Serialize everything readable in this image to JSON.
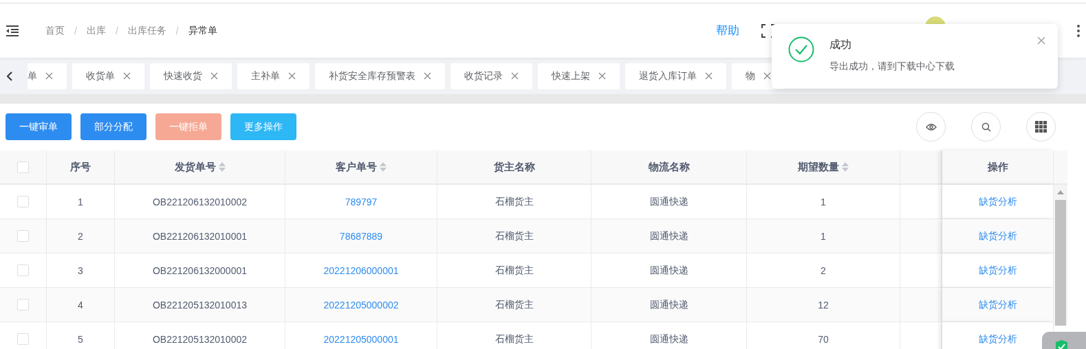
{
  "header": {
    "breadcrumb": [
      "首页",
      "出库",
      "出库任务",
      "异常单"
    ],
    "separators": [
      "/",
      "/",
      "/"
    ],
    "help": "帮助"
  },
  "tabs": [
    {
      "label": "单"
    },
    {
      "label": "收货单"
    },
    {
      "label": "快速收货"
    },
    {
      "label": "主补单"
    },
    {
      "label": "补货安全库存预警表"
    },
    {
      "label": "收货记录"
    },
    {
      "label": "快速上架"
    },
    {
      "label": "退货入库订单"
    },
    {
      "label": "物"
    }
  ],
  "toast": {
    "title": "成功",
    "message": "导出成功，请到下载中心下载"
  },
  "actions": [
    {
      "label": "一键审单",
      "kind": "primary",
      "disabled": false
    },
    {
      "label": "部分分配",
      "kind": "primary",
      "disabled": false
    },
    {
      "label": "一键拒单",
      "kind": "danger",
      "disabled": true
    },
    {
      "label": "更多操作",
      "kind": "info",
      "disabled": false
    }
  ],
  "table": {
    "select_all": {
      "checked": false
    },
    "columns": [
      {
        "label": "序号",
        "sortable": false
      },
      {
        "label": "发货单号",
        "sortable": true
      },
      {
        "label": "客户单号",
        "sortable": true
      },
      {
        "label": "货主名称",
        "sortable": false
      },
      {
        "label": "物流名称",
        "sortable": false
      },
      {
        "label": "期望数量",
        "sortable": true
      },
      {
        "label": "操作",
        "sortable": false
      }
    ],
    "rows": [
      {
        "checked": false,
        "index": "1",
        "outbound_no": "OB221206132010002",
        "customer_no": "789797",
        "owner": "石榴货主",
        "carrier": "圆通快递",
        "quantity": "1",
        "action": "缺货分析"
      },
      {
        "checked": false,
        "index": "2",
        "outbound_no": "OB221206132010001",
        "customer_no": "78687889",
        "owner": "石榴货主",
        "carrier": "圆通快递",
        "quantity": "1",
        "action": "缺货分析"
      },
      {
        "checked": false,
        "index": "3",
        "outbound_no": "OB221206132000001",
        "customer_no": "20221206000001",
        "owner": "石榴货主",
        "carrier": "圆通快递",
        "quantity": "2",
        "action": "缺货分析"
      },
      {
        "checked": false,
        "index": "4",
        "outbound_no": "OB221205132010013",
        "customer_no": "20221205000002",
        "owner": "石榴货主",
        "carrier": "圆通快递",
        "quantity": "12",
        "action": "缺货分析"
      },
      {
        "checked": false,
        "index": "5",
        "outbound_no": "OB221205132010002",
        "customer_no": "20221205000001",
        "owner": "石榴货主",
        "carrier": "圆通快递",
        "quantity": "70",
        "action": "缺货分析"
      }
    ]
  }
}
